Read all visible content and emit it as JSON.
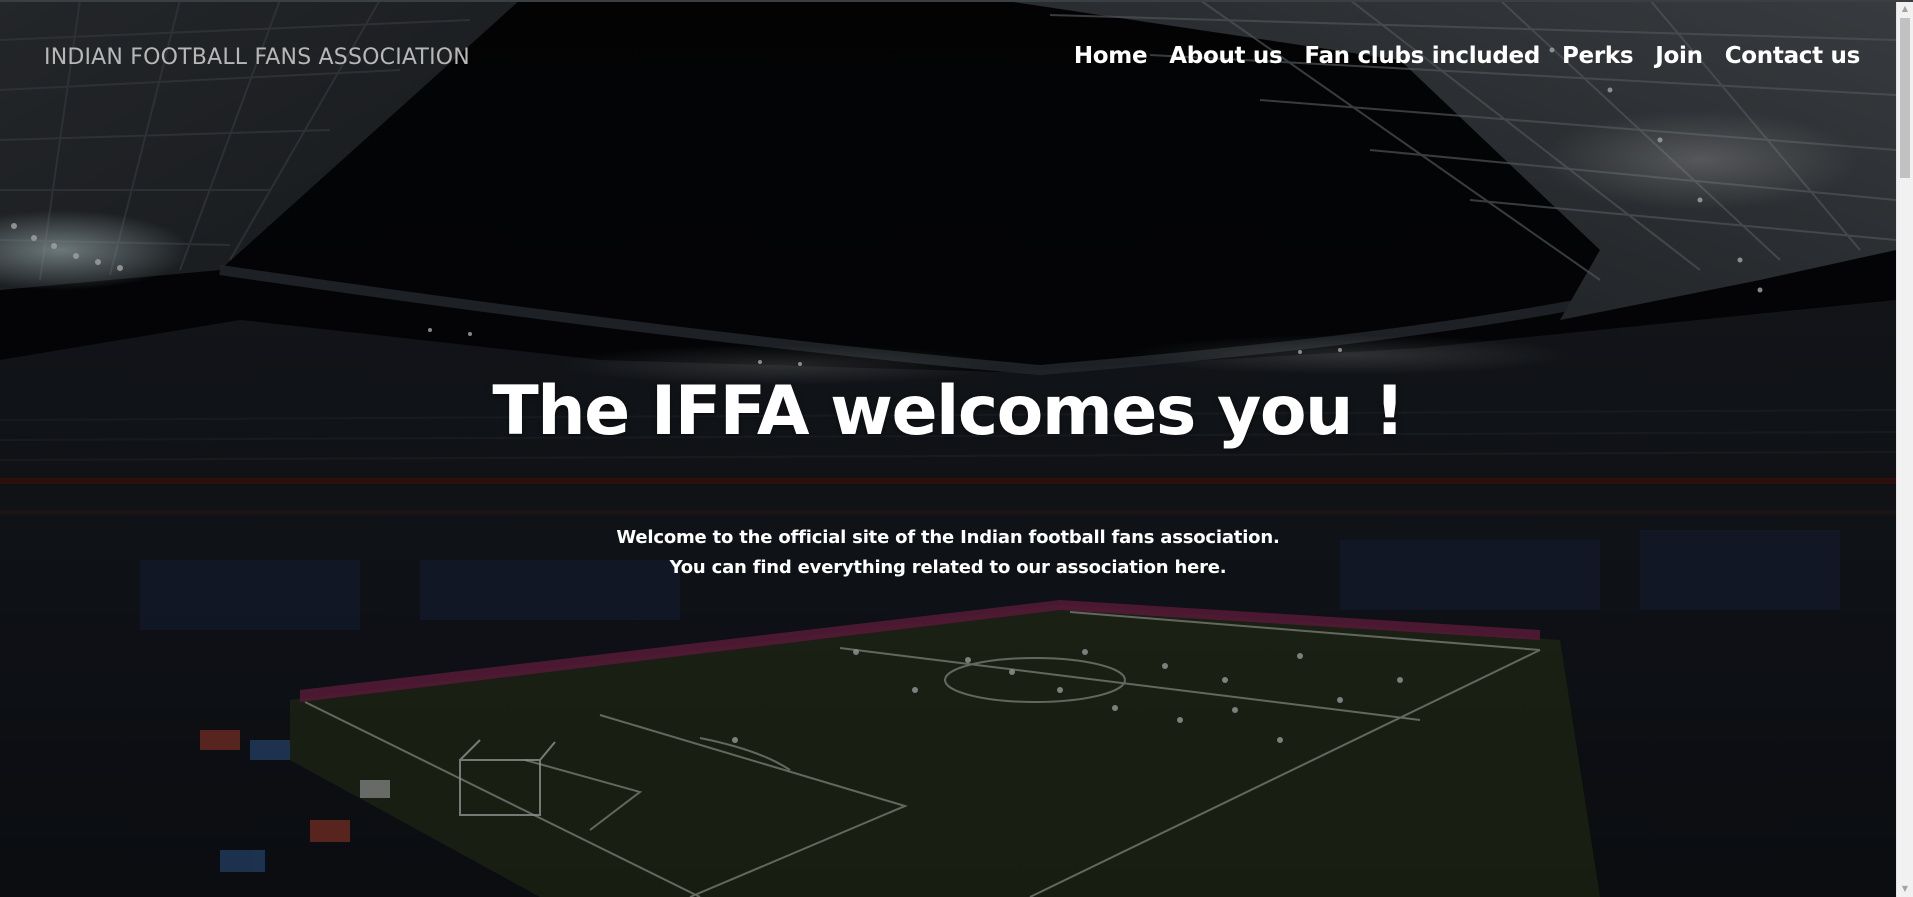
{
  "navbar": {
    "brand": "INDIAN FOOTBALL FANS ASSOCIATION",
    "links": [
      "Home",
      "About us",
      "Fan clubs included",
      "Perks",
      "Join",
      "Contact us"
    ]
  },
  "hero": {
    "title": "The IFFA welcomes you !",
    "subtitle_line1": "Welcome to the official site of the Indian football fans association.",
    "subtitle_line2": "You can find everything related to our association here.",
    "background_icon": "stadium-background-image"
  },
  "scrollbar": {
    "up_icon": "▲",
    "down_icon": "▼"
  },
  "colors": {
    "brand_text": "#b7b7b7",
    "nav_text": "#ffffff",
    "overlay": "#000000",
    "pitch": "#2c3a1e"
  }
}
